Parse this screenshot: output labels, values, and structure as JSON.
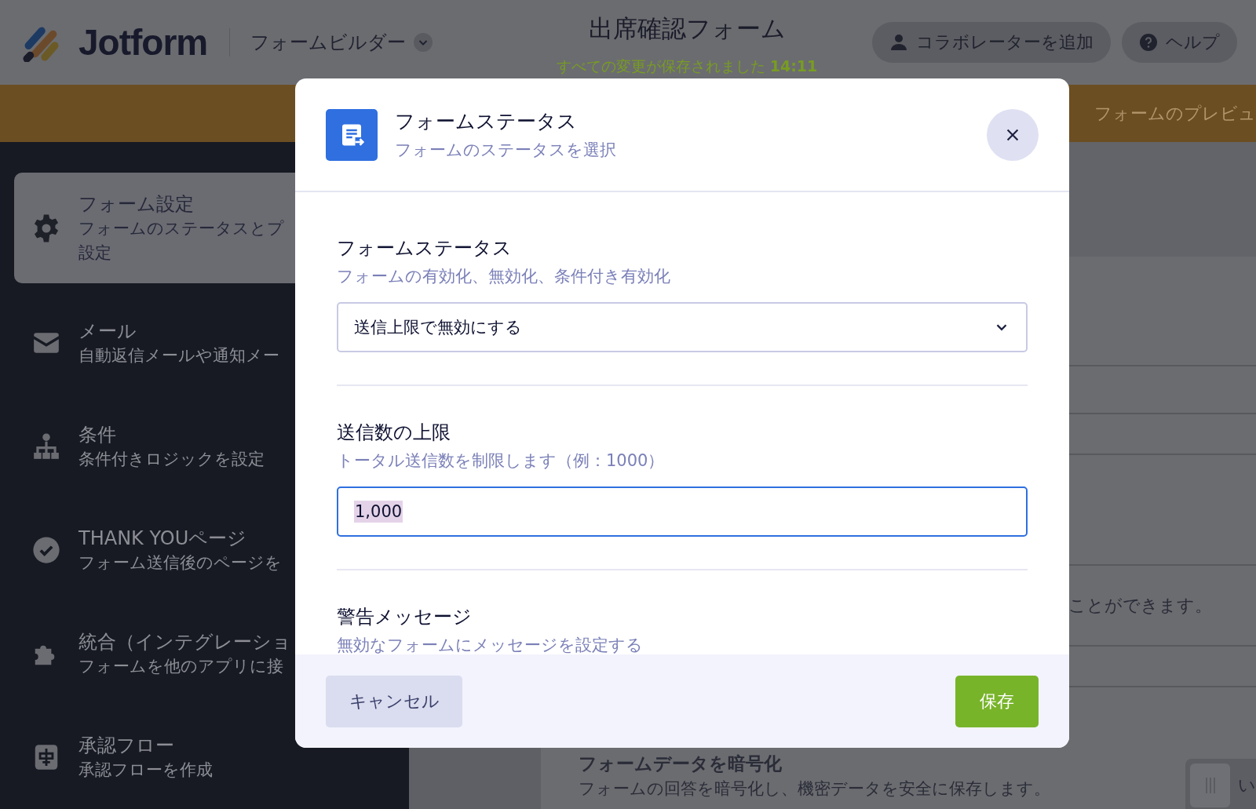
{
  "header": {
    "logo": "Jotform",
    "builder_menu": "フォームビルダー",
    "form_title": "出席確認フォーム",
    "save_status": "すべての変更が保存されました **14:11**",
    "buttons": [
      {
        "kind": "collaborator",
        "label": "コラボレーターを追加"
      },
      {
        "kind": "help",
        "label": "ヘルプ"
      }
    ]
  },
  "preview_bar": {
    "label": "フォームのプレビュ"
  },
  "sidebar": {
    "items": [
      {
        "kind": "settings",
        "title": "フォーム設定",
        "description": [
          "フォームのステータスとプ",
          "設定"
        ],
        "selected": true
      },
      {
        "kind": "email",
        "title": "メール",
        "description": [
          "自動返信メールや通知メー"
        ],
        "selected": false
      },
      {
        "kind": "conditions",
        "title": "条件",
        "description": [
          "条件付きロジックを設定"
        ],
        "selected": false
      },
      {
        "kind": "thankyou",
        "title": "THANK YOUページ",
        "description": [
          "フォーム送信後のページを"
        ],
        "selected": false
      },
      {
        "kind": "integrations",
        "title": "統合（インテグレーショ",
        "description": [
          "フォームを他のアプリに接"
        ],
        "selected": false
      },
      {
        "kind": "approval",
        "title": "承認フロー",
        "description": [
          "承認フローを作成"
        ],
        "selected": false
      }
    ]
  },
  "content": {
    "note": "ことができます。",
    "encryption": {
      "title": "フォームデータを暗号化",
      "description": "フォームの回答を暗号化し、機密データを安全に保存します。"
    },
    "toggle": {
      "label": "い",
      "on": false
    }
  },
  "dialog": {
    "title": "フォームステータス",
    "subtitle": "フォームのステータスを選択",
    "sections": [
      {
        "kind": "select",
        "title": "フォームステータス",
        "description": "フォームの有効化、無効化、条件付き有効化",
        "value": "送信上限で無効にする"
      },
      {
        "kind": "input",
        "title": "送信数の上限",
        "description": "トータル送信数を制限します（例：1000）",
        "value": "1,000",
        "value_selected": true,
        "focused": true
      },
      {
        "kind": "text",
        "title": "警告メッセージ",
        "description": "無効なフォームにメッセージを設定する"
      }
    ],
    "buttons": [
      {
        "kind": "cancel",
        "label": "キャンセル"
      },
      {
        "kind": "save",
        "label": "保存"
      }
    ]
  }
}
